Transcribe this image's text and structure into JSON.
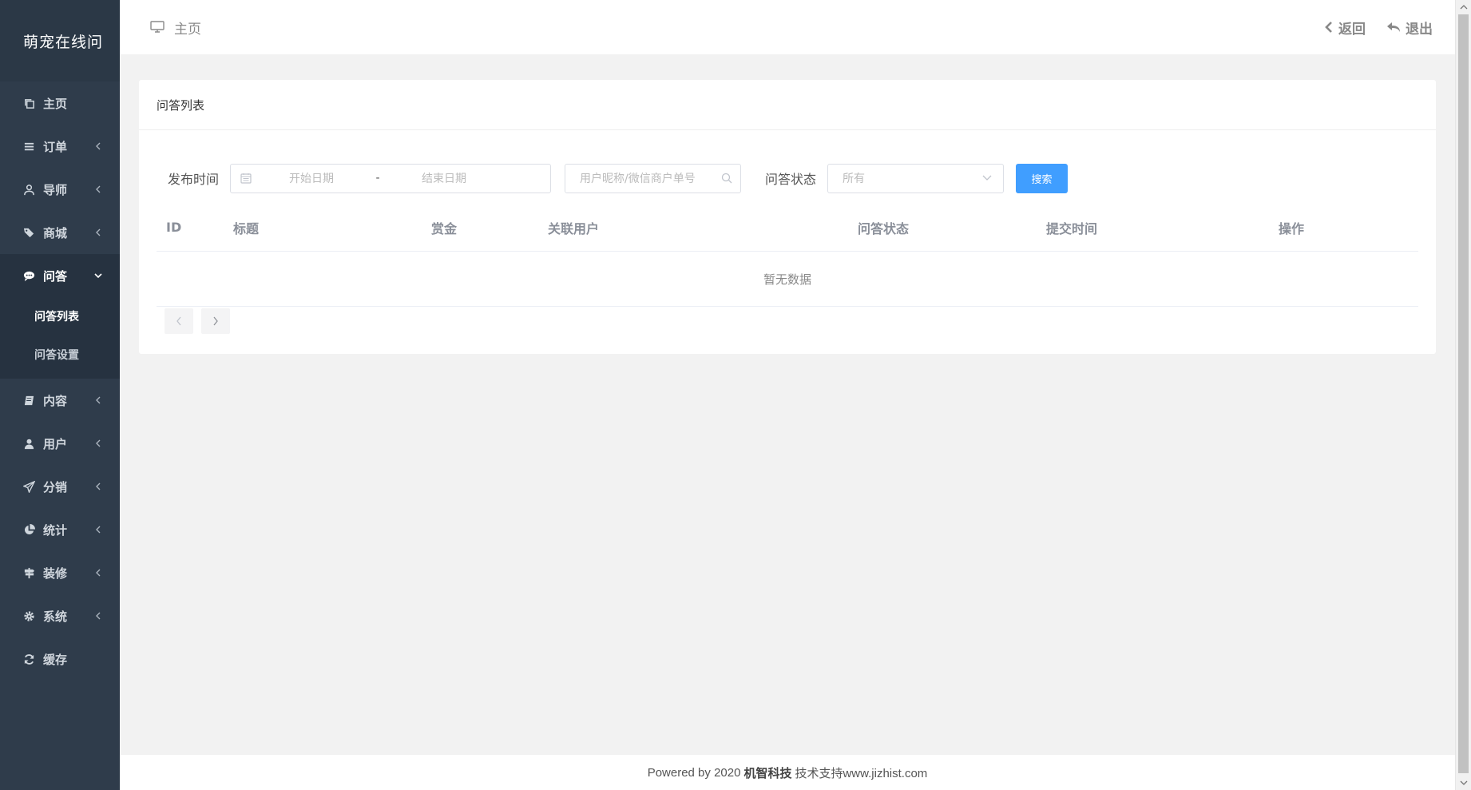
{
  "app": {
    "title": "萌宠在线问"
  },
  "sidebar": {
    "items": [
      {
        "label": "主页",
        "icon": "copy-icon",
        "has_children": false
      },
      {
        "label": "订单",
        "icon": "list-icon",
        "has_children": true
      },
      {
        "label": "导师",
        "icon": "user-outline-icon",
        "has_children": true
      },
      {
        "label": "商城",
        "icon": "tags-icon",
        "has_children": true
      },
      {
        "label": "问答",
        "icon": "comment-icon",
        "has_children": true,
        "open": true,
        "children": [
          {
            "label": "问答列表",
            "active": true
          },
          {
            "label": "问答设置"
          }
        ]
      },
      {
        "label": "内容",
        "icon": "book-icon",
        "has_children": true
      },
      {
        "label": "用户",
        "icon": "user-icon",
        "has_children": true
      },
      {
        "label": "分销",
        "icon": "paper-plane-icon",
        "has_children": true
      },
      {
        "label": "统计",
        "icon": "pie-chart-icon",
        "has_children": true
      },
      {
        "label": "装修",
        "icon": "signpost-icon",
        "has_children": true
      },
      {
        "label": "系统",
        "icon": "gear-icon",
        "has_children": true
      },
      {
        "label": "缓存",
        "icon": "refresh-icon",
        "has_children": false
      }
    ]
  },
  "header": {
    "breadcrumb": "主页",
    "back_label": "返回",
    "logout_label": "退出"
  },
  "card": {
    "title": "问答列表",
    "filters": {
      "publish_time_label": "发布时间",
      "start_placeholder": "开始日期",
      "range_separator": "-",
      "end_placeholder": "结束日期",
      "search_placeholder": "用户昵称/微信商户单号",
      "status_label": "问答状态",
      "status_selected": "所有",
      "search_button": "搜索"
    },
    "table": {
      "columns": [
        "ID",
        "标题",
        "赏金",
        "关联用户",
        "问答状态",
        "提交时间",
        "操作"
      ],
      "empty_text": "暂无数据"
    }
  },
  "footer": {
    "prefix": "Powered by 2020",
    "company": "机智科技",
    "suffix": "技术支持www.jizhist.com"
  },
  "colors": {
    "sidebar_bg": "#2f3c4b",
    "primary": "#409eff"
  }
}
